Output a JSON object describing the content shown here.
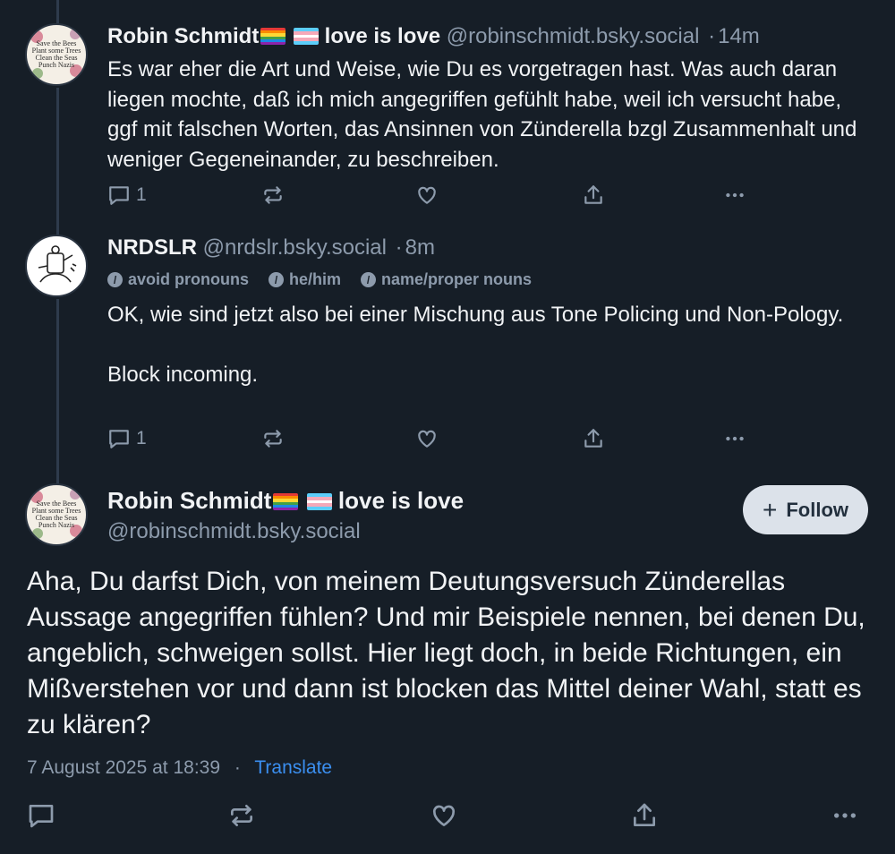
{
  "thread": [
    {
      "avatar_text": "Save the Bees\nPlant some Trees\nClean the Seas\nPunch Nazis",
      "display_name": "Robin Schmidt",
      "name_suffix": " love is love",
      "handle": "@robinschmidt.bsky.social",
      "separator": "·",
      "time": "14m",
      "text": "Es war eher die Art und Weise, wie Du es vorgetragen hast. Was auch daran liegen mochte, daß ich mich angegriffen gefühlt habe, weil ich versucht habe, ggf mit falschen Worten, das Ansinnen von Zünderella bzgl Zusammenhalt und weniger Gegeneinander, zu beschreiben.",
      "reply_count": "1"
    },
    {
      "display_name": "NRDSLR",
      "handle": "@nrdslr.bsky.social",
      "separator": "·",
      "time": "8m",
      "pronouns": [
        "avoid pronouns",
        "he/him",
        "name/proper nouns"
      ],
      "pronoun_icon": "/",
      "text_line1": "OK, wie sind jetzt also bei einer Mischung aus Tone Policing und Non-Pology.",
      "text_line2": "Block incoming.",
      "reply_count": "1"
    }
  ],
  "main_post": {
    "avatar_text": "Save the Bees\nPlant some Trees\nClean the Seas\nPunch Nazis",
    "display_name": "Robin Schmidt",
    "name_suffix": " love is love",
    "handle": "@robinschmidt.bsky.social",
    "follow_label": "Follow",
    "follow_icon": "+",
    "text": "Aha, Du darfst Dich, von meinem Deutungsversuch Zünderellas Aussage angegriffen fühlen? Und mir Beispiele nennen, bei denen Du, angeblich, schweigen sollst. Hier liegt doch, in beide Richtungen, ein Mißverstehen vor und dann ist blocken das Mittel deiner Wahl, statt es zu klären?",
    "date": "7 August 2025 at 18:39",
    "separator": "·",
    "translate_label": "Translate"
  },
  "icons": [
    "reply-icon",
    "repost-icon",
    "like-icon",
    "share-icon",
    "more-icon"
  ],
  "colors": {
    "background": "#161e27",
    "text": "#f1f3f5",
    "muted": "#8d9bac",
    "link": "#3b8ff0",
    "follow_bg": "#dce2ea"
  }
}
